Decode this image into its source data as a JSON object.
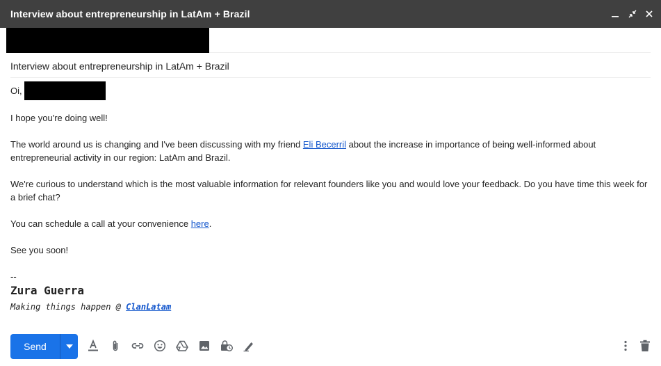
{
  "window": {
    "title": "Interview about entrepreneurship in LatAm + Brazil",
    "controls": [
      "minimize-icon",
      "exit-fullscreen-icon",
      "close-icon"
    ]
  },
  "compose": {
    "subject": "Interview about entrepreneurship in LatAm + Brazil"
  },
  "body": {
    "greeting": "Oi,",
    "line1": "I hope you're doing well!",
    "p2_before": "The world around us is changing and I've been discussing with my friend ",
    "p2_link": "Eli Becerril",
    "p2_after": " about the increase in importance of being well-informed about entrepreneurial activity in our region: LatAm and Brazil.",
    "p3": "We're curious to understand which is the most valuable information for relevant founders like you and would love your feedback. Do you have time this week for a brief chat?",
    "p4_before": "You can schedule a call at your convenience ",
    "p4_link": "here",
    "p4_after": ".",
    "p5": "See you soon!"
  },
  "signature": {
    "dash": "--",
    "name": "Zura Guerra",
    "tagline_before": "Making things happen @ ",
    "tagline_link": "ClanLatam"
  },
  "toolbar": {
    "send_label": "Send",
    "icons": [
      "format-text-icon",
      "attach-icon",
      "link-icon",
      "emoji-icon",
      "drive-icon",
      "photo-icon",
      "confidential-mode-icon",
      "signature-icon",
      "more-options-icon",
      "discard-icon"
    ]
  },
  "colors": {
    "titlebar": "#404040",
    "accent": "#1a73e8",
    "link": "#1155cc"
  }
}
